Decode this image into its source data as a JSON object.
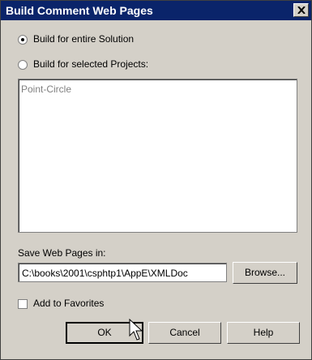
{
  "window": {
    "title": "Build Comment Web Pages"
  },
  "options": {
    "entire_solution_label": "Build for entire Solution",
    "selected_projects_label": "Build for selected Projects:",
    "selected": "entire_solution"
  },
  "projects_list": {
    "items": [
      "Point-Circle"
    ]
  },
  "save": {
    "label": "Save Web Pages in:",
    "path": "C:\\books\\2001\\csphtp1\\AppE\\XMLDoc",
    "browse_label": "Browse..."
  },
  "favorites": {
    "label": "Add to Favorites",
    "checked": false
  },
  "buttons": {
    "ok": "OK",
    "cancel": "Cancel",
    "help": "Help"
  }
}
